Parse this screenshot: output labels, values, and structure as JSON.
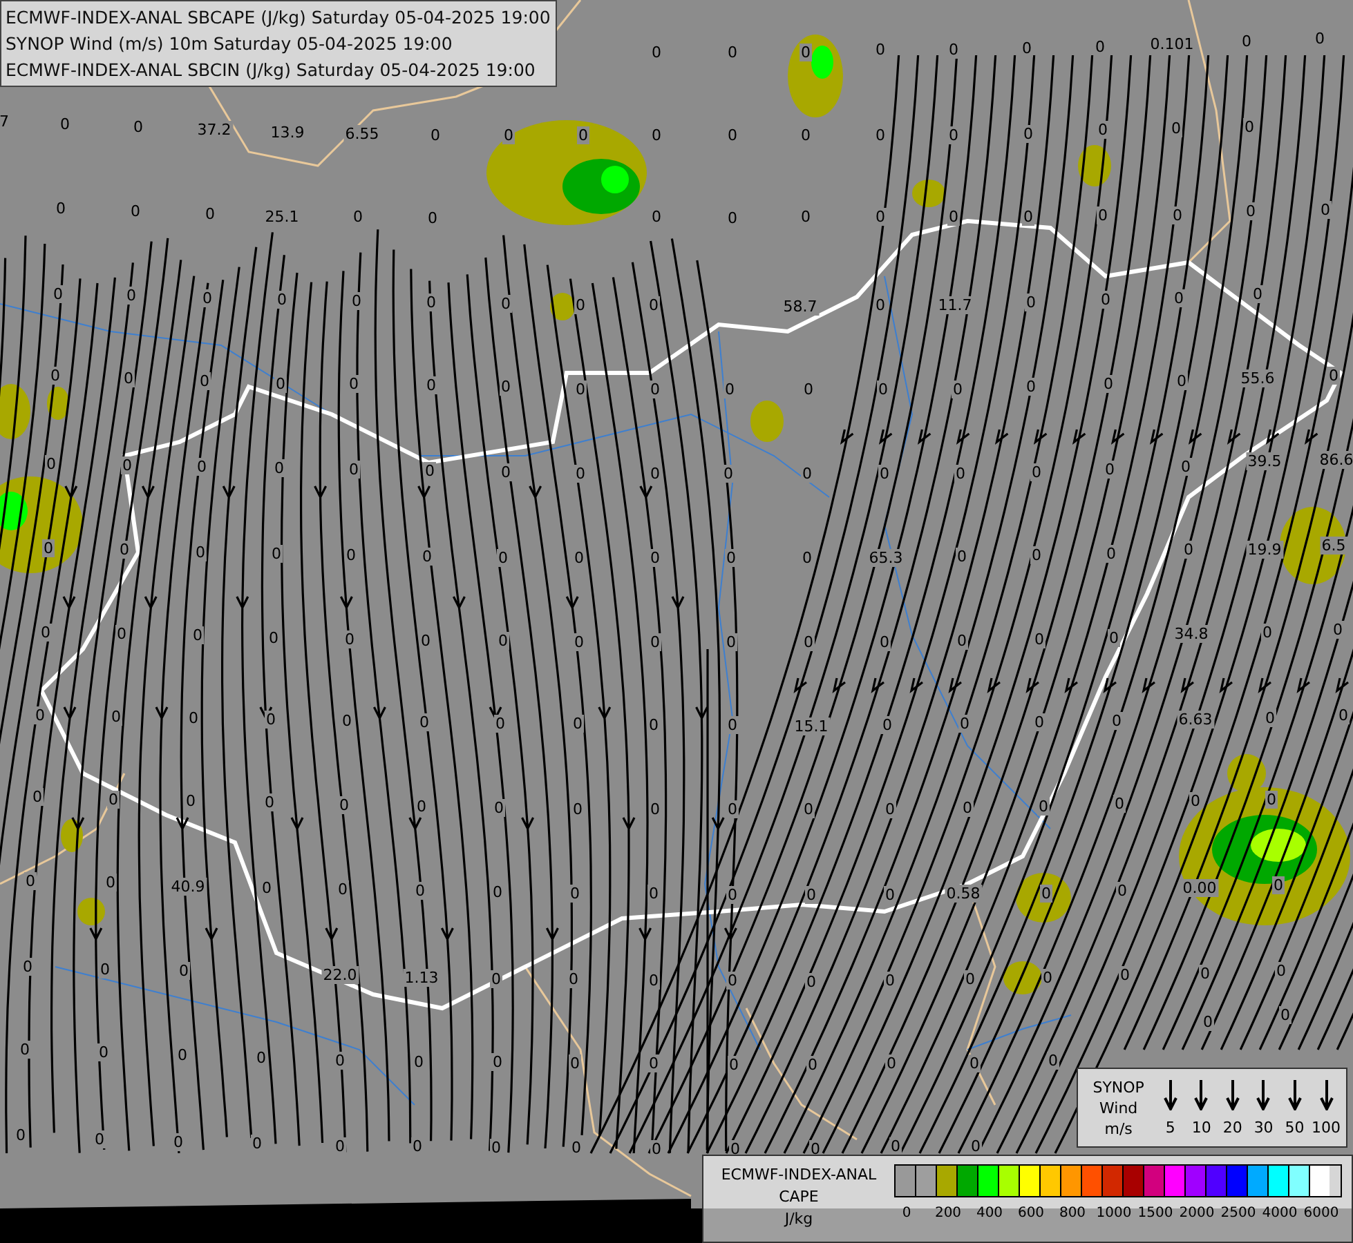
{
  "title_lines": [
    "ECMWF-INDEX-ANAL SBCAPE (J/kg) Saturday 05-04-2025 19:00",
    "SYNOP Wind (m/s) 10m Saturday 05-04-2025 19:00",
    "ECMWF-INDEX-ANAL SBCIN (J/kg) Saturday 05-04-2025 19:00"
  ],
  "station_values": [
    "0",
    "0",
    "0",
    "0",
    "0",
    "0",
    "0",
    "0.101",
    "0",
    "0",
    "7",
    "0",
    "0",
    "37.2",
    "13.9",
    "6.55",
    "0",
    "0",
    "0",
    "0",
    "0",
    "0",
    "0",
    "0",
    "0",
    "0",
    "0",
    "0",
    "0",
    "0",
    "0",
    "25.1",
    "0",
    "0",
    "0",
    "0",
    "0",
    "0",
    "0",
    "0",
    "0",
    "0",
    "0",
    "0",
    "0",
    "0",
    "0",
    "0",
    "0",
    "0",
    "0",
    "0",
    "0",
    "58.7",
    "0",
    "11.7",
    "0",
    "0",
    "0",
    "0",
    "0",
    "0",
    "0",
    "0",
    "0",
    "0",
    "0",
    "0",
    "0",
    "0",
    "0",
    "0",
    "0",
    "0",
    "0",
    "0",
    "55.6",
    "0",
    "0",
    "0",
    "0",
    "0",
    "0",
    "0",
    "0",
    "0",
    "0",
    "0",
    "0",
    "0",
    "0",
    "0",
    "0",
    "0",
    "39.5",
    "86.6",
    "0",
    "0",
    "0",
    "0",
    "0",
    "0",
    "0",
    "0",
    "0",
    "0",
    "0",
    "65.3",
    "0",
    "0",
    "0",
    "0",
    "19.9",
    "6.5",
    "0",
    "0",
    "0",
    "0",
    "0",
    "0",
    "0",
    "0",
    "0",
    "0",
    "0",
    "0",
    "0",
    "0",
    "0",
    "34.8",
    "0",
    "0",
    "0",
    "0",
    "0",
    "0",
    "0",
    "0",
    "0",
    "0",
    "0",
    "0",
    "15.1",
    "0",
    "0",
    "0",
    "0",
    "6.63",
    "0",
    "0",
    "0",
    "0",
    "0",
    "0",
    "0",
    "0",
    "0",
    "0",
    "0",
    "0",
    "0",
    "0",
    "0",
    "0",
    "0",
    "0",
    "0",
    "0",
    "0",
    "40.9",
    "0",
    "0",
    "0",
    "0",
    "0",
    "0",
    "0",
    "0",
    "0",
    "0.58",
    "0",
    "0",
    "0.00",
    "0",
    "0",
    "0",
    "0",
    "22.0",
    "1.13",
    "0",
    "0",
    "0",
    "0",
    "0",
    "0",
    "0",
    "0",
    "0",
    "0",
    "0",
    "0",
    "0",
    "0",
    "0",
    "0",
    "0",
    "0",
    "0",
    "0",
    "0",
    "0",
    "0",
    "0",
    "0",
    "0",
    "0",
    "0",
    "0",
    "0",
    "0",
    "0",
    "0",
    "0",
    "0",
    "0",
    "0",
    "0",
    "0",
    "0"
  ],
  "synop_legend": {
    "title_lines": [
      "SYNOP",
      "Wind",
      "m/s"
    ],
    "speeds": [
      "5",
      "10",
      "20",
      "30",
      "50",
      "100"
    ]
  },
  "cape_legend": {
    "title_lines": [
      "ECMWF-INDEX-ANAL",
      "CAPE",
      "J/kg"
    ],
    "swatches": [
      {
        "color": "#999999"
      },
      {
        "color": "#9e9e9e"
      },
      {
        "color": "#a8a800"
      },
      {
        "color": "#00a800"
      },
      {
        "color": "#00ff00"
      },
      {
        "color": "#a8ff00"
      },
      {
        "color": "#ffff00"
      },
      {
        "color": "#ffc800"
      },
      {
        "color": "#ff9600"
      },
      {
        "color": "#ff5000"
      },
      {
        "color": "#d22800"
      },
      {
        "color": "#a80000"
      },
      {
        "color": "#d2007e"
      },
      {
        "color": "#ff00ff"
      },
      {
        "color": "#a000ff"
      },
      {
        "color": "#5000ff"
      },
      {
        "color": "#0000ff"
      },
      {
        "color": "#00aaff"
      },
      {
        "color": "#00ffff"
      },
      {
        "color": "#80ffff"
      },
      {
        "color": "#ffffff"
      }
    ],
    "ticks": [
      "0",
      "200",
      "400",
      "600",
      "800",
      "1000",
      "1500",
      "2000",
      "2500",
      "4000",
      "6000"
    ]
  }
}
